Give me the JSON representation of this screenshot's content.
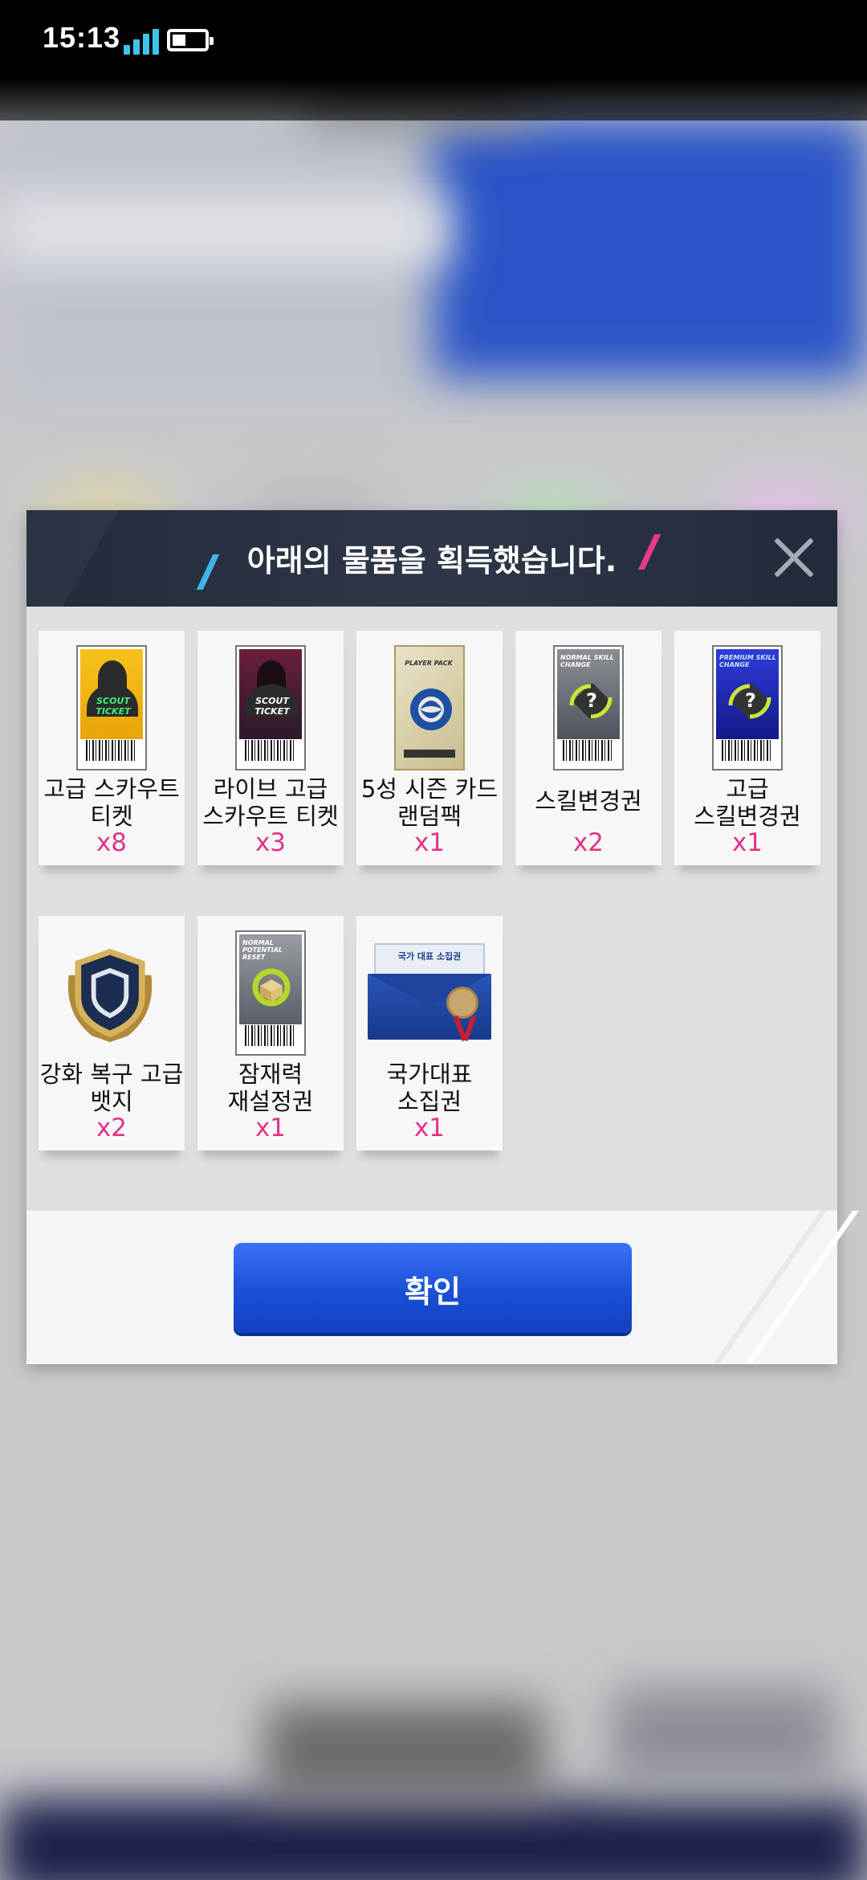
{
  "status_bar": {
    "time": "15:13"
  },
  "dialog": {
    "title": "아래의 물품을 획득했습니다.",
    "confirm_label": "확인",
    "items": [
      {
        "name": "고급 스카우트\n티켓",
        "qty": "x8",
        "art_text": "SCOUT\nTICKET"
      },
      {
        "name": "라이브 고급\n스카우트 티켓",
        "qty": "x3",
        "art_text": "SCOUT\nTICKET"
      },
      {
        "name": "5성 시즌 카드\n랜덤팩",
        "qty": "x1",
        "art_text": "PLAYER PACK"
      },
      {
        "name": "스킬변경권",
        "qty": "x2",
        "art_text": "NORMAL\nSKILL CHANGE"
      },
      {
        "name": "고급\n스킬변경권",
        "qty": "x1",
        "art_text": "PREMIUM\nSKILL CHANGE"
      },
      {
        "name": "강화 복구 고급\n뱃지",
        "qty": "x2"
      },
      {
        "name": "잠재력\n재설정권",
        "qty": "x1",
        "art_text": "NORMAL\nPOTENTIAL RESET"
      },
      {
        "name": "국가대표\n소집권",
        "qty": "x1",
        "art_text": "국가 대표 소집권"
      }
    ]
  },
  "colors": {
    "header_bg": "#2a3344",
    "quantity": "#e0338a",
    "confirm_button": "#1b4fd6",
    "accent_blue": "#3fb4e8",
    "accent_pink": "#e83a8c"
  },
  "icons": [
    "signal-icon",
    "battery-icon",
    "close-icon"
  ]
}
